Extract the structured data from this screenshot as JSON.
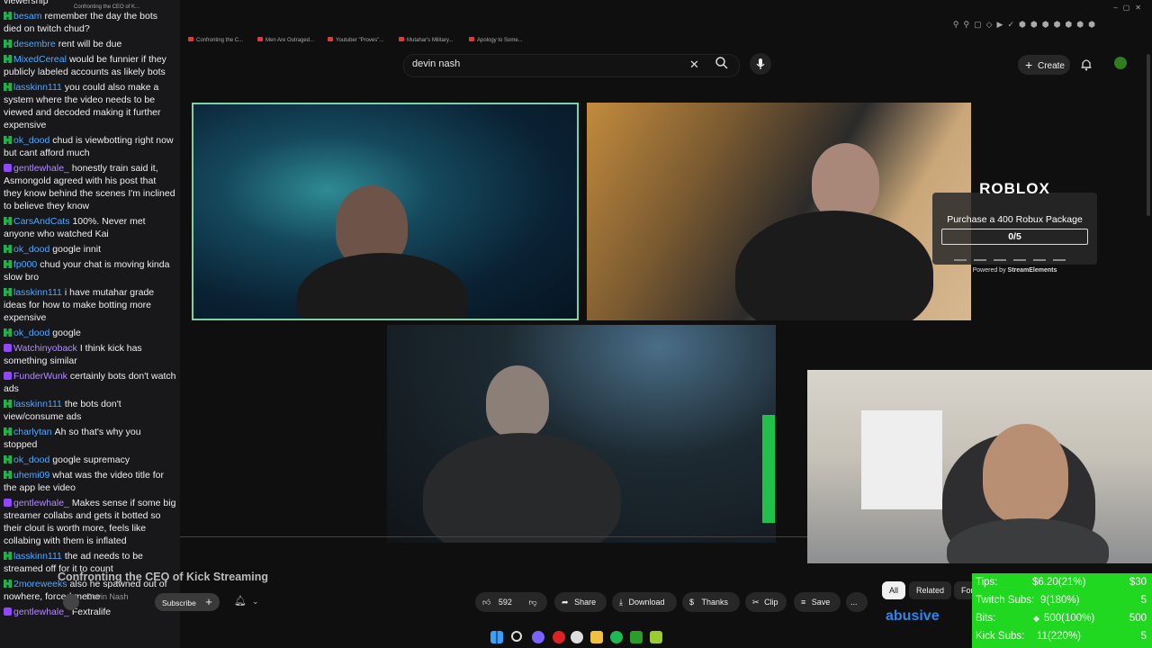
{
  "chat": {
    "messages": [
      {
        "user": "",
        "text": "viewership",
        "badge": "none"
      },
      {
        "user": "besam",
        "text": "remember the day the bots died on twitch chud?",
        "badge": "green"
      },
      {
        "user": "desembre",
        "text": "rent will be due",
        "badge": "green"
      },
      {
        "user": "MixedCereal",
        "text": "would be funnier if they publicly labeled accounts as likely bots",
        "badge": "green"
      },
      {
        "user": "lasskinn111",
        "text": "you could also make a system where the video needs to be viewed and decoded making it further expensive",
        "badge": "green"
      },
      {
        "user": "ok_dood",
        "text": "chud is viewbotting right now but cant afford much",
        "badge": "green"
      },
      {
        "user": "gentlewhale_",
        "text": "honestly train said it, Asmongold agreed with his post that they know behind the scenes I'm inclined to believe they know",
        "badge": "purple"
      },
      {
        "user": "CarsAndCats",
        "text": "100%. Never met anyone who watched Kai",
        "badge": "green"
      },
      {
        "user": "ok_dood",
        "text": "google innit",
        "badge": "green"
      },
      {
        "user": "fp000",
        "text": "chud your chat is moving kinda slow bro",
        "badge": "green"
      },
      {
        "user": "lasskinn111",
        "text": "i have mutahar grade ideas for how to make botting more expensive",
        "badge": "green"
      },
      {
        "user": "ok_dood",
        "text": "google",
        "badge": "green"
      },
      {
        "user": "Watchinyoback",
        "text": "I think kick has something similar",
        "badge": "purple"
      },
      {
        "user": "FunderWunk",
        "text": "certainly bots don't watch ads",
        "badge": "purple"
      },
      {
        "user": "lasskinn111",
        "text": "the bots don't view/consume ads",
        "badge": "green"
      },
      {
        "user": "charlytan",
        "text": "Ah so that's why you stopped",
        "badge": "green"
      },
      {
        "user": "ok_dood",
        "text": "google supremacy",
        "badge": "green"
      },
      {
        "user": "uhemi09",
        "text": "what was the video title for the app lee video",
        "badge": "green"
      },
      {
        "user": "gentlewhale_",
        "text": "Makes sense if some big streamer collabs and gets it botted so their clout is worth more, feels like collabing with them is inflated",
        "badge": "purple"
      },
      {
        "user": "lasskinn111",
        "text": "the ad needs to be streamed off for it to count",
        "badge": "green"
      },
      {
        "user": "2moreweeks",
        "text": "also he spawned out of nowhere, forced meme",
        "badge": "green"
      },
      {
        "user": "gentlewhale_",
        "text": "Fextralife",
        "badge": "purple"
      }
    ]
  },
  "browser": {
    "tab_title": "Confronting the CEO of K...",
    "bookmarks": [
      "Confronting the C...",
      "Men Are Outraged...",
      "Youtuber \"Proves\"...",
      "Mutahar's Military...",
      "Apology to Some..."
    ],
    "search_value": "devin nash",
    "create_label": "Create"
  },
  "roblox": {
    "logo": "ROBLOX",
    "goal_text": "Purchase a 400 Robux Package",
    "progress_text": "0/5",
    "progress_fraction": 0.0,
    "powered_prefix": "Powered by",
    "powered_brand": "StreamElements"
  },
  "video": {
    "title": "Confronting the CEO of Kick Streaming",
    "channel": "Devin Nash",
    "subscribe_label": "Subscribe",
    "likes": "592",
    "share_label": "Share",
    "download_label": "Download",
    "thanks_label": "Thanks",
    "clip_label": "Clip",
    "save_label": "Save",
    "more_label": "...",
    "chips": [
      "All",
      "Related",
      "For"
    ],
    "overlay_word": "abusive"
  },
  "stats": {
    "tips_label": "Tips:",
    "tips_value": "$6.20(21%)",
    "tips_goal": "$30",
    "twitch_label": "Twitch Subs:",
    "twitch_value": "9(180%)",
    "twitch_goal": "5",
    "bits_label": "Bits:",
    "bits_value": "500(100%)",
    "bits_goal": "500",
    "kick_label": "Kick Subs:",
    "kick_value": "11(220%)",
    "kick_goal": "5"
  },
  "colors": {
    "chat_bg": "#18181b",
    "stats_bg": "#1fd81f",
    "accent_blue": "#2b86e8"
  }
}
